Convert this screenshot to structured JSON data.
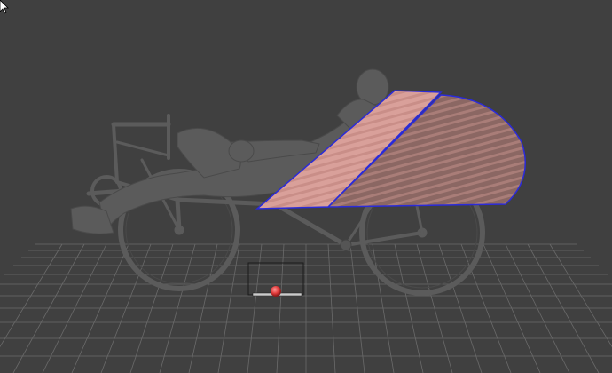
{
  "viewport": {
    "background": "#404040",
    "grid_color": "#6a6a6a",
    "model_color": "#5b5b5b",
    "model_edge": "#4a4a4a",
    "fairing_fill": "#d9a09a",
    "fairing_dark": "#8b6763",
    "fairing_edge": "#2b2bd9",
    "marker_color": "#e03a3a"
  },
  "icons": {
    "cursor": "mouse-pointer-icon",
    "marker": "pivot-marker-icon"
  }
}
